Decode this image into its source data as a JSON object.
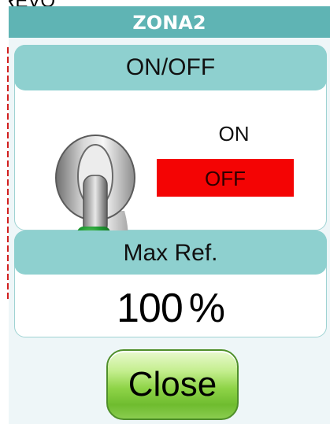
{
  "background_title": "REVO",
  "window": {
    "title": "ZONA2"
  },
  "onoff": {
    "label": "ON/OFF",
    "on_text": "ON",
    "off_text": "OFF",
    "state": "OFF"
  },
  "max_ref": {
    "label": "Max Ref.",
    "value": "100",
    "unit": "%"
  },
  "buttons": {
    "close_label": "Close"
  },
  "colors": {
    "header": "#5fb4b4",
    "section_header": "#8ed0cf",
    "off_indicator": "#f40404",
    "close_button": "#8fd448"
  }
}
